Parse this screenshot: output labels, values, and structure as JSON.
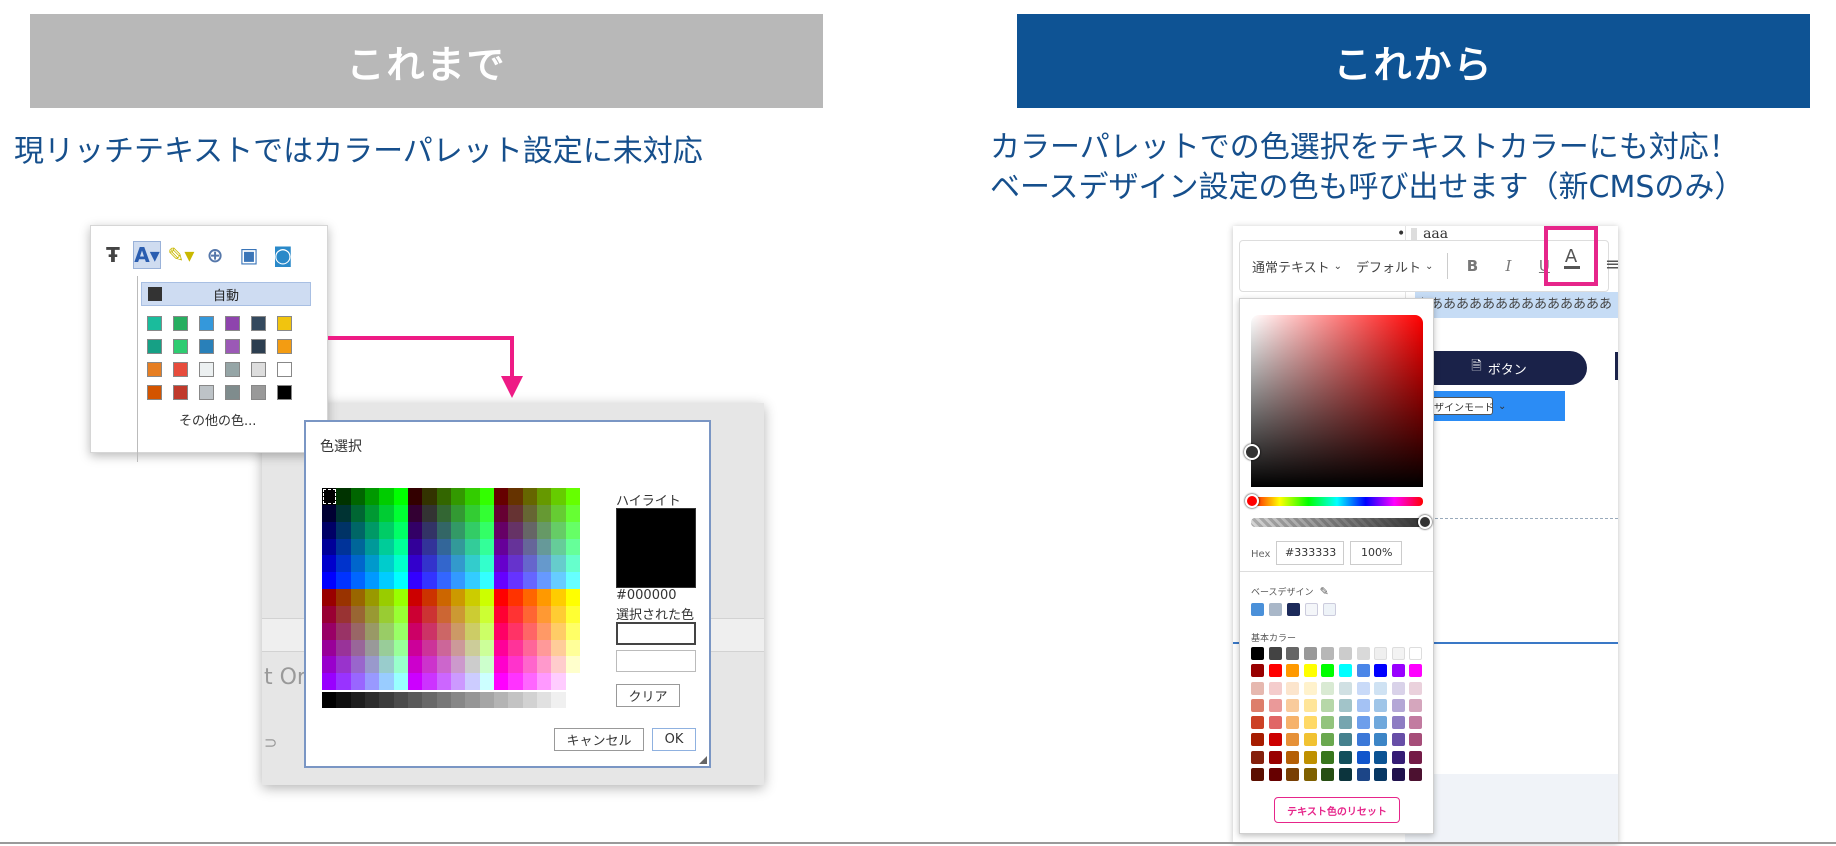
{
  "headers": {
    "old": "これまで",
    "new": "これから"
  },
  "descriptions": {
    "old": "現リッチテキストではカラーパレット設定に未対応",
    "new_line1": "カラーパレットでの色選択をテキストカラーにも対応！",
    "new_line2": "ベースデザイン設定の色も呼び出せます（新CMSのみ）"
  },
  "old_palette": {
    "auto_label": "自動",
    "more_colors_label": "その他の色...",
    "swatches": [
      [
        "#1abc9c",
        "#27ae60",
        "#3498db",
        "#8e44ad",
        "#34495e",
        "#f1c40f"
      ],
      [
        "#16a085",
        "#2ecc71",
        "#2980b9",
        "#9b59b6",
        "#2c3e50",
        "#f39c12"
      ],
      [
        "#e67e22",
        "#e74c3c",
        "#ecf0f1",
        "#95a5a6",
        "#dddddd",
        "#ffffff"
      ],
      [
        "#d35400",
        "#c0392b",
        "#bdc3c7",
        "#7f8c8d",
        "#999999",
        "#000000"
      ]
    ]
  },
  "old_dialog": {
    "title": "色選択",
    "highlight_label": "ハイライト",
    "highlight_hex": "#000000",
    "selected_label": "選択された色",
    "clear_label": "クリア",
    "cancel_label": "キャンセル",
    "ok_label": "OK",
    "ghost_text": "t Or",
    "ghost_text2": "⊃"
  },
  "new_editor": {
    "bullet_text": "•",
    "aaa_text": "aaa",
    "style_select": "通常テキスト",
    "font_select": "デフォルト",
    "bold_label": "B",
    "italic_label": "I",
    "underline_label": "U",
    "text_color_label": "A",
    "align_label": "≡",
    "highlight_text": "あああああああああああああああ",
    "button_label": "ボタン",
    "mode_select": "デザインモード"
  },
  "new_picker": {
    "hex_label": "Hex",
    "hex_value": "#333333",
    "opacity_value": "100%",
    "base_design_label": "ベースデザイン",
    "base_colors": [
      "#4a90d9",
      "#a9b7c8",
      "#1c2a5a",
      "#f4f6f9",
      "#eef3f8"
    ],
    "basic_label": "基本カラー",
    "reset_label": "テキスト色のリセット",
    "basic_colors": [
      [
        "#000000",
        "#434343",
        "#666666",
        "#999999",
        "#b7b7b7",
        "#cccccc",
        "#d9d9d9",
        "#efefef",
        "#f3f3f3",
        "#ffffff"
      ],
      [
        "#980000",
        "#ff0000",
        "#ff9900",
        "#ffff00",
        "#00ff00",
        "#00ffff",
        "#4a86e8",
        "#0000ff",
        "#9900ff",
        "#ff00ff"
      ],
      [
        "#e6b8af",
        "#f4cccc",
        "#fce5cd",
        "#fff2cc",
        "#d9ead3",
        "#d0e0e3",
        "#c9daf8",
        "#cfe2f3",
        "#d9d2e9",
        "#ead1dc"
      ],
      [
        "#dd7e6b",
        "#ea9999",
        "#f9cb9c",
        "#ffe599",
        "#b6d7a8",
        "#a2c4c9",
        "#a4c2f4",
        "#9fc5e8",
        "#b4a7d6",
        "#d5a6bd"
      ],
      [
        "#cc4125",
        "#e06666",
        "#f6b26b",
        "#ffd966",
        "#93c47d",
        "#76a5af",
        "#6d9eeb",
        "#6fa8dc",
        "#8e7cc3",
        "#c27ba0"
      ],
      [
        "#a61c00",
        "#cc0000",
        "#e69138",
        "#f1c232",
        "#6aa84f",
        "#45818e",
        "#3c78d8",
        "#3d85c6",
        "#674ea7",
        "#a64d79"
      ],
      [
        "#85200c",
        "#990000",
        "#b45f06",
        "#bf9000",
        "#38761d",
        "#134f5c",
        "#1155cc",
        "#0b5394",
        "#351c75",
        "#741b47"
      ],
      [
        "#5b0f00",
        "#660000",
        "#783f04",
        "#7f6000",
        "#274e13",
        "#0c343d",
        "#1c4587",
        "#073763",
        "#20124d",
        "#4c1130"
      ]
    ]
  }
}
